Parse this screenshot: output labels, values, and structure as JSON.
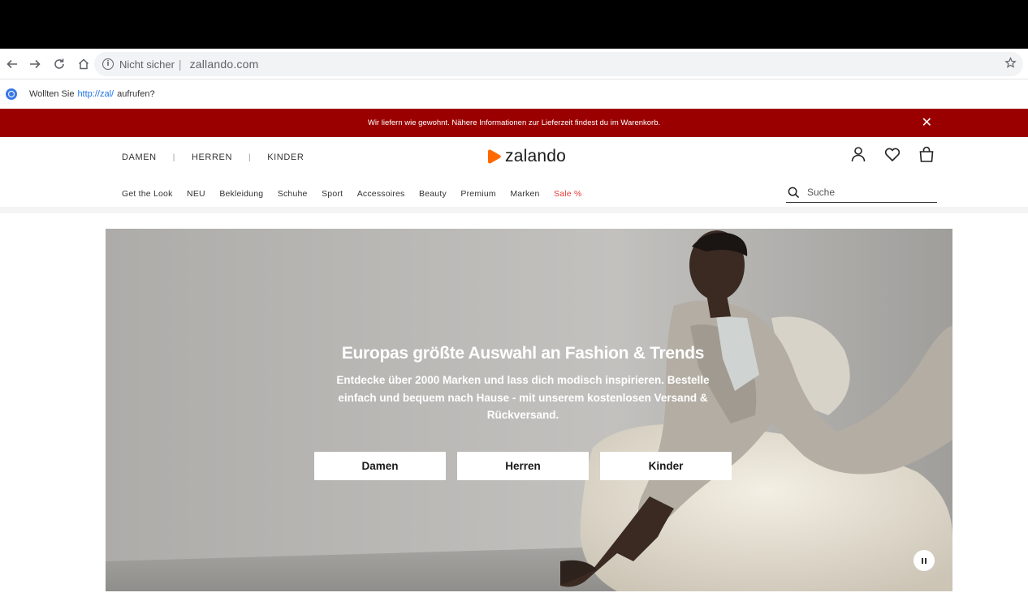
{
  "browser": {
    "not_secure_label": "Nicht sicher",
    "separator": "|",
    "url": "zallando.com"
  },
  "suggestion": {
    "prefix": "Wollten Sie",
    "link": "http://zal/",
    "suffix": "aufrufen?"
  },
  "promo": {
    "text": "Wir liefern wie gewohnt. Nähere Informationen zur Lieferzeit findest du im Warenkorb.",
    "close_glyph": "✕"
  },
  "header": {
    "gender_nav": [
      "DAMEN",
      "HERREN",
      "KINDER"
    ],
    "logo_text": "zalando",
    "categories": [
      "Get the Look",
      "NEU",
      "Bekleidung",
      "Schuhe",
      "Sport",
      "Accessoires",
      "Beauty",
      "Premium",
      "Marken",
      "Sale %"
    ],
    "search_placeholder": "Suche"
  },
  "hero": {
    "title": "Europas größte Auswahl an Fashion & Trends",
    "subtitle": "Entdecke über 2000 Marken und lass dich modisch inspirieren. Bestelle einfach und bequem nach Hause - mit unserem kostenlosen Versand & Rückversand.",
    "buttons": [
      "Damen",
      "Herren",
      "Kinder"
    ]
  },
  "colors": {
    "promo_bg": "#9b0000",
    "brand_orange": "#ff6900",
    "sale_red": "#e53935"
  }
}
